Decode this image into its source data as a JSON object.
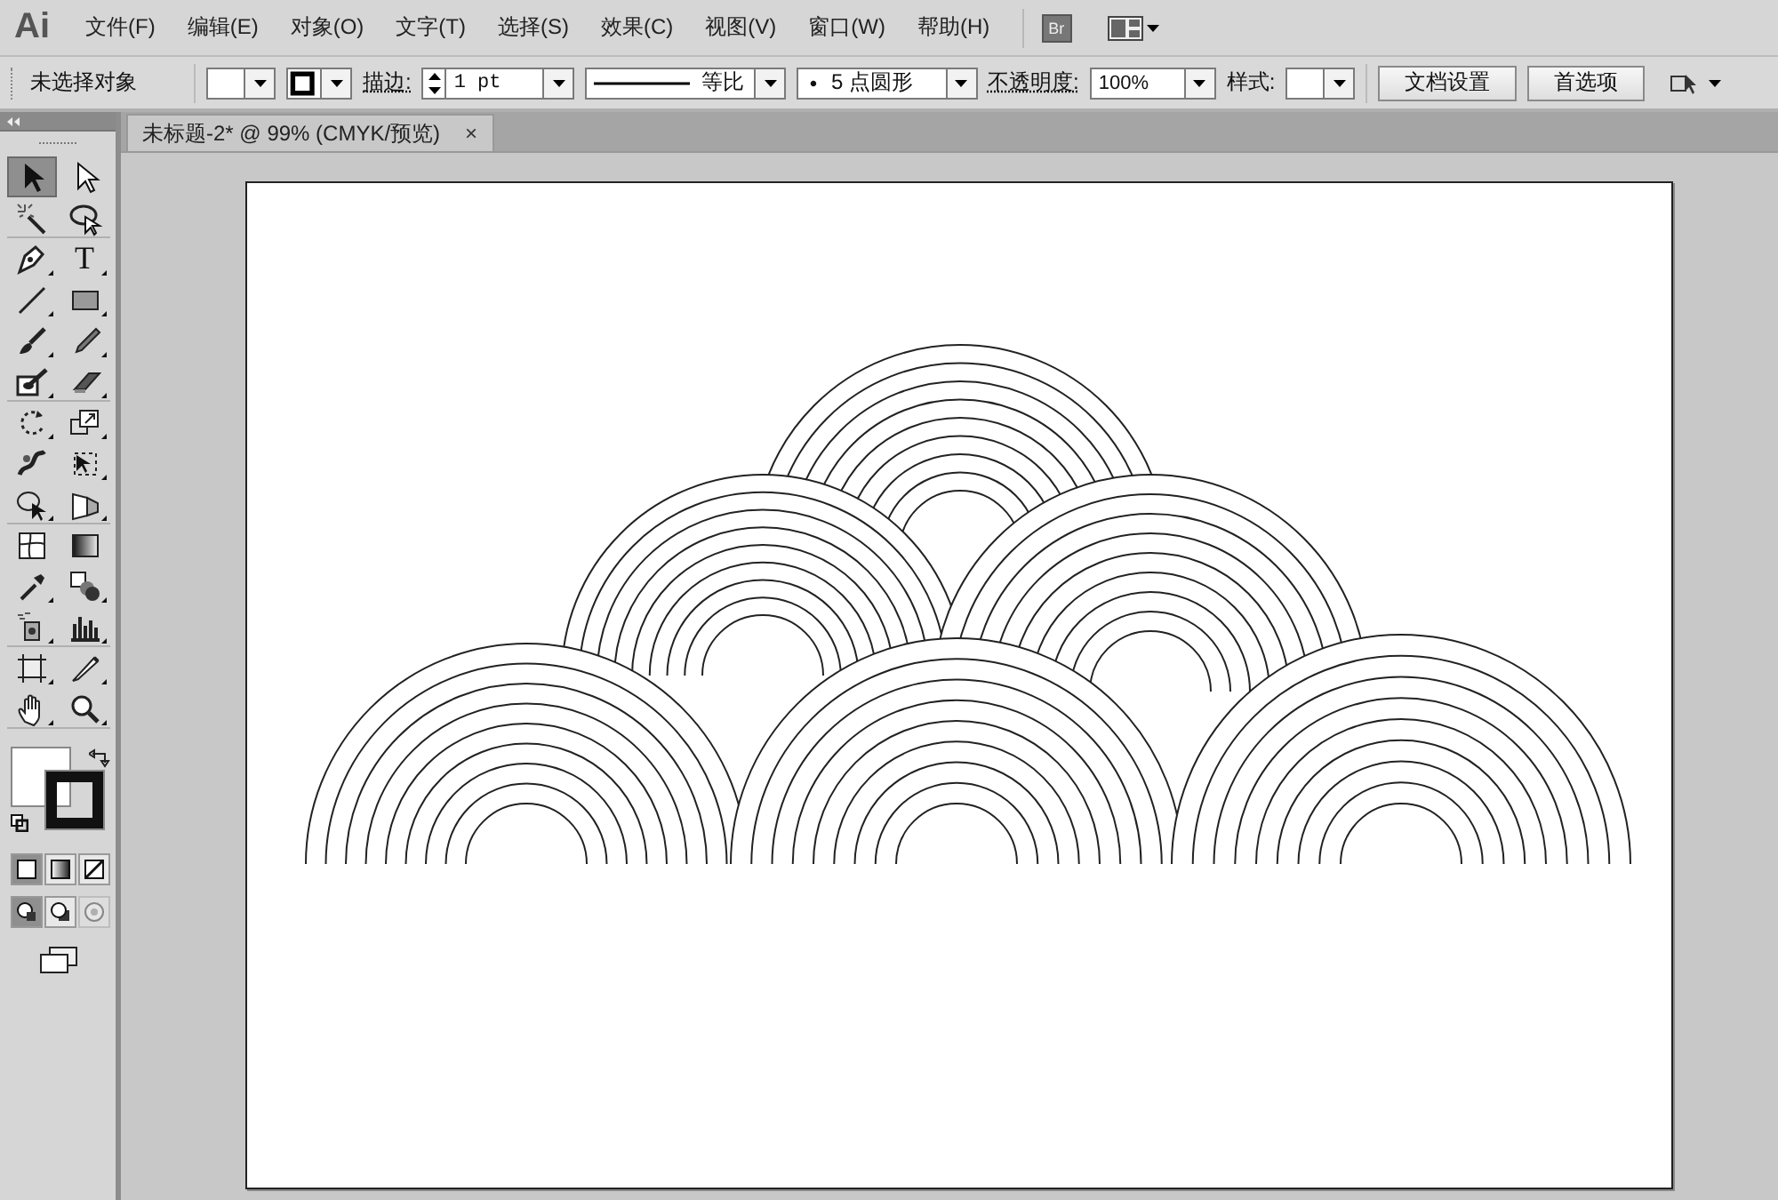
{
  "app": {
    "logo": "Ai"
  },
  "menu": [
    {
      "label": "文件(F)"
    },
    {
      "label": "编辑(E)"
    },
    {
      "label": "对象(O)"
    },
    {
      "label": "文字(T)"
    },
    {
      "label": "选择(S)"
    },
    {
      "label": "效果(C)"
    },
    {
      "label": "视图(V)"
    },
    {
      "label": "窗口(W)"
    },
    {
      "label": "帮助(H)"
    }
  ],
  "bridge_badge": "Br",
  "control_bar": {
    "selection": "未选择对象",
    "stroke_label": "描边:",
    "stroke_weight": "1 pt",
    "profile": "等比",
    "brush_dot": "•",
    "brush": "5 点圆形",
    "opacity_label": "不透明度:",
    "opacity": "100%",
    "style_label": "样式:",
    "buttons": [
      "文档设置",
      "首选项"
    ]
  },
  "document_tab": {
    "title": "未标题-2* @ 99% (CMYK/预览)",
    "close": "×",
    "selected": true
  },
  "tools": [
    {
      "kind": "selection",
      "selected": true
    },
    {
      "kind": "direct-selection",
      "selected": false
    },
    {
      "kind": "magic-wand",
      "selected": false
    },
    {
      "kind": "lasso",
      "selected": false
    },
    {
      "kind": "pen",
      "selected": false
    },
    {
      "kind": "type",
      "selected": false,
      "glyph": "T"
    },
    {
      "kind": "line",
      "selected": false
    },
    {
      "kind": "rectangle",
      "selected": false
    },
    {
      "kind": "brush",
      "selected": false
    },
    {
      "kind": "pencil",
      "selected": false
    },
    {
      "kind": "blob",
      "selected": false
    },
    {
      "kind": "eraser",
      "selected": false
    },
    {
      "kind": "rotate",
      "selected": false
    },
    {
      "kind": "scale",
      "selected": false
    },
    {
      "kind": "warp",
      "selected": false
    },
    {
      "kind": "free-transform",
      "selected": false
    },
    {
      "kind": "shape-builder",
      "selected": false
    },
    {
      "kind": "perspective",
      "selected": false
    },
    {
      "kind": "mesh",
      "selected": false
    },
    {
      "kind": "gradient",
      "selected": false
    },
    {
      "kind": "eyedropper",
      "selected": false
    },
    {
      "kind": "blend",
      "selected": false
    },
    {
      "kind": "sprayer",
      "selected": false
    },
    {
      "kind": "graph",
      "selected": false
    },
    {
      "kind": "artboard",
      "selected": false
    },
    {
      "kind": "slice",
      "selected": false
    },
    {
      "kind": "hand",
      "selected": false
    },
    {
      "kind": "zoom",
      "selected": false
    }
  ],
  "color_modes": [
    {
      "kind": "color",
      "selected": true
    },
    {
      "kind": "gradient",
      "selected": false
    },
    {
      "kind": "none",
      "selected": false
    }
  ],
  "draw_modes": [
    {
      "kind": "normal",
      "selected": true,
      "disabled": false
    },
    {
      "kind": "behind",
      "selected": false,
      "disabled": false
    },
    {
      "kind": "inside",
      "selected": false,
      "disabled": true
    }
  ]
}
